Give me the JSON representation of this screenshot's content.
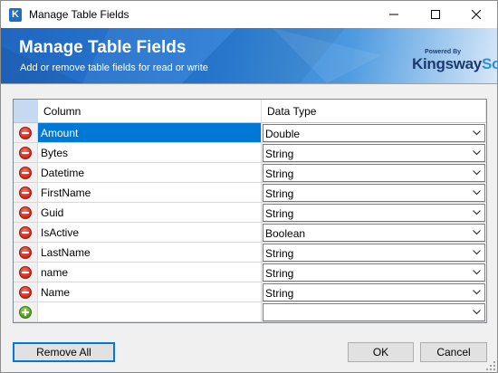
{
  "window": {
    "title": "Manage Table Fields",
    "app_icon_letter": "K"
  },
  "banner": {
    "title": "Manage Table Fields",
    "subtitle": "Add or remove table fields for read or write",
    "logo_powered": "Powered By",
    "logo_brand_a": "Kingsway",
    "logo_brand_b": "Soft"
  },
  "grid": {
    "headers": {
      "column": "Column",
      "data_type": "Data Type"
    },
    "rows": [
      {
        "column": "Amount",
        "data_type": "Double",
        "selected": true
      },
      {
        "column": "Bytes",
        "data_type": "String"
      },
      {
        "column": "Datetime",
        "data_type": "String"
      },
      {
        "column": "FirstName",
        "data_type": "String"
      },
      {
        "column": "Guid",
        "data_type": "String"
      },
      {
        "column": "IsActive",
        "data_type": "Boolean"
      },
      {
        "column": "LastName",
        "data_type": "String"
      },
      {
        "column": "name",
        "data_type": "String"
      },
      {
        "column": "Name",
        "data_type": "String"
      }
    ],
    "new_row": {
      "column": "",
      "data_type": ""
    }
  },
  "buttons": {
    "remove_all": "Remove All",
    "ok": "OK",
    "cancel": "Cancel"
  },
  "colors": {
    "banner": "#2a7dd6",
    "selection": "#0078d7",
    "focus_border": "#0078d7"
  },
  "icons": {
    "remove_row": "minus-circle-icon",
    "add_row": "plus-circle-icon"
  }
}
